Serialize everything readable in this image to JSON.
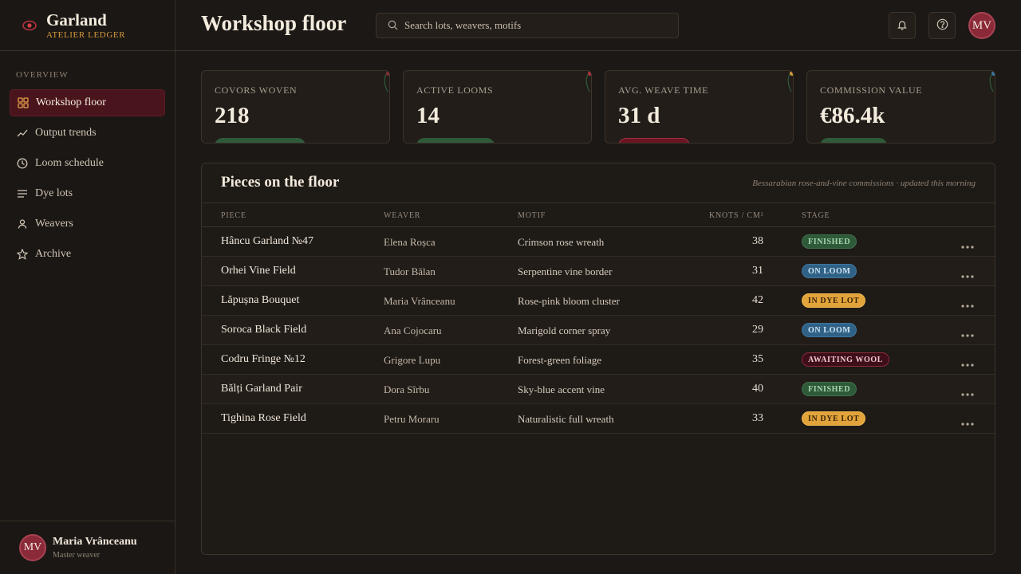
{
  "brand": {
    "name": "Garland",
    "subtitle": "ATELIER LEDGER"
  },
  "sidebar": {
    "section": "OVERVIEW",
    "items": [
      {
        "label": "Workshop floor",
        "icon": "grid-icon",
        "active": true
      },
      {
        "label": "Output trends",
        "icon": "trend-icon",
        "active": false
      },
      {
        "label": "Loom schedule",
        "icon": "clock-icon",
        "active": false
      },
      {
        "label": "Dye lots",
        "icon": "list-icon",
        "active": false
      },
      {
        "label": "Weavers",
        "icon": "user-icon",
        "active": false
      },
      {
        "label": "Archive",
        "icon": "star-icon",
        "active": false
      }
    ],
    "user": {
      "initials": "MV",
      "name": "Maria Vrânceanu",
      "role": "Master weaver"
    }
  },
  "header": {
    "title": "Workshop floor",
    "search_placeholder": "Search lots, weavers, motifs",
    "avatar_initials": "MV"
  },
  "cards": [
    {
      "label": "COVORS WOVEN",
      "value": "218",
      "accent": "#2f5a3a"
    },
    {
      "label": "ACTIVE LOOMS",
      "value": "14",
      "accent": "#2f5a3a"
    },
    {
      "label": "AVG. WEAVE TIME",
      "value": "31 d",
      "accent": "#6a1422"
    },
    {
      "label": "COMMISSION VALUE",
      "value": "€86.4k",
      "accent": "#2f5a3a"
    }
  ],
  "table": {
    "title": "Pieces on the floor",
    "note": "Bessarabian rose-and-vine commissions · updated this morning",
    "columns": {
      "piece": "PIECE",
      "weaver": "WEAVER",
      "motif": "MOTIF",
      "knots": "KNOTS / CM²",
      "stage": "STAGE"
    },
    "rows": [
      {
        "piece": "Hâncu Garland №47",
        "weaver": "Elena Roșca",
        "motif": "Crimson rose wreath",
        "knots": "38",
        "stage": "FINISHED",
        "stage_kind": "finished"
      },
      {
        "piece": "Orhei Vine Field",
        "weaver": "Tudor Bălan",
        "motif": "Serpentine vine border",
        "knots": "31",
        "stage": "ON LOOM",
        "stage_kind": "onloom"
      },
      {
        "piece": "Lăpușna Bouquet",
        "weaver": "Maria Vrânceanu",
        "motif": "Rose-pink bloom cluster",
        "knots": "42",
        "stage": "IN DYE LOT",
        "stage_kind": "dyelot"
      },
      {
        "piece": "Soroca Black Field",
        "weaver": "Ana Cojocaru",
        "motif": "Marigold corner spray",
        "knots": "29",
        "stage": "ON LOOM",
        "stage_kind": "onloom"
      },
      {
        "piece": "Codru Fringe №12",
        "weaver": "Grigore Lupu",
        "motif": "Forest-green foliage",
        "knots": "35",
        "stage": "AWAITING WOOL",
        "stage_kind": "awaiting"
      },
      {
        "piece": "Bălți Garland Pair",
        "weaver": "Dora Sîrbu",
        "motif": "Sky-blue accent vine",
        "knots": "40",
        "stage": "FINISHED",
        "stage_kind": "finished"
      },
      {
        "piece": "Tighina Rose Field",
        "weaver": "Petru Moraru",
        "motif": "Naturalistic full wreath",
        "knots": "33",
        "stage": "IN DYE LOT",
        "stage_kind": "dyelot"
      }
    ]
  }
}
